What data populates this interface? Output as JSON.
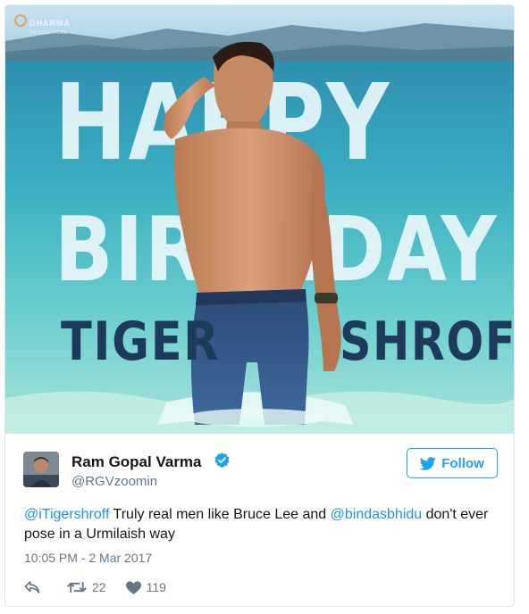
{
  "photo": {
    "brand_name": "DHARMA",
    "brand_sub": "PRODUCTIONS",
    "line1": "HAPPY",
    "line2": "BIRTHDAY",
    "line3_left": "TIGER",
    "line3_right": "SHROFF"
  },
  "tweet": {
    "author_name": "Ram Gopal Varma",
    "author_handle": "@RGVzoomin",
    "follow_label": "Follow",
    "text_parts": {
      "mention1": "@iTigershroff",
      "middle": " Truly real men like Bruce Lee and ",
      "mention2": "@bindasbhidu",
      "end": " don't ever pose in a Urmilaish way"
    },
    "timestamp": "10:05 PM - 2 Mar 2017",
    "retweets": "22",
    "likes": "119"
  },
  "colors": {
    "accent": "#1da1f2",
    "link": "#1b95e0",
    "muted": "#657786",
    "text": "#14171a"
  },
  "icons": [
    "reply-icon",
    "retweet-icon",
    "heart-icon",
    "verified-badge-icon",
    "twitter-bird-icon"
  ]
}
